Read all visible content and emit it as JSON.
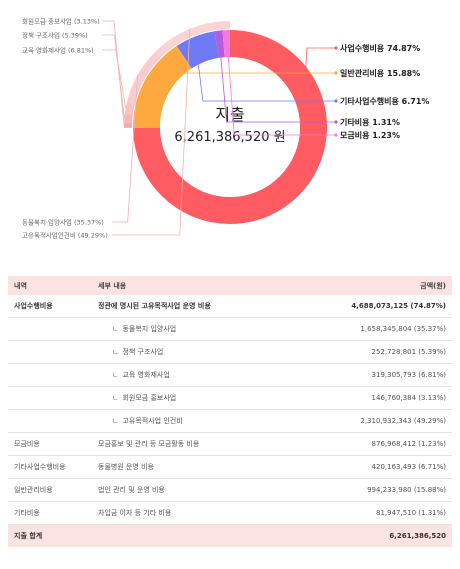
{
  "chart_data": {
    "type": "pie",
    "center_title": "지출",
    "center_value": "6,261,386,520 원",
    "slices": [
      {
        "label": "사업수행비용",
        "value": 74.87,
        "text": "사업수행비용 74.87%",
        "color": "#fe5c62"
      },
      {
        "label": "일반관리비용",
        "value": 15.88,
        "text": "일반관리비용 15.88%",
        "color": "#fea940"
      },
      {
        "label": "기타사업수행비용",
        "value": 6.71,
        "text": "기타사업수행비용 6.71%",
        "color": "#6f79f4"
      },
      {
        "label": "기타비용",
        "value": 1.31,
        "text": "기타비용 1.31%",
        "color": "#b45cdd"
      },
      {
        "label": "모금비용",
        "value": 1.23,
        "text": "모금비용 1.23%",
        "color": "#f57ae0"
      }
    ],
    "sub_slices": [
      {
        "label": "고유목적사업인건비",
        "value": 49.29,
        "text": "고유목적사업인건비 (49.29%)",
        "color": "#fbd3d3"
      },
      {
        "label": "동물복지·입양사업",
        "value": 35.37,
        "text": "동물복지·입양사업 (35.37%)",
        "color": "#fccccc"
      },
      {
        "label": "교육·영화제사업",
        "value": 6.81,
        "text": "교육·영화제사업 (6.81%)",
        "color": "#fbc2c2"
      },
      {
        "label": "정책·구조사업",
        "value": 5.39,
        "text": "정책·구조사업 (5.39%)",
        "color": "#fab6b6"
      },
      {
        "label": "회원모금·홍보사업",
        "value": 3.13,
        "text": "회원모금·홍보사업 (3.13%)",
        "color": "#f9a9a9"
      }
    ]
  },
  "table": {
    "headers": {
      "col1": "내역",
      "col2": "세부 내용",
      "col3": "금액(원)"
    },
    "rows": [
      {
        "cat": "사업수행비용",
        "detail": "정관에 명시된 고유목적사업 운영 비용",
        "amount": "4,688,073,125 (74.87%)",
        "bold": true
      },
      {
        "cat": "",
        "detail": "동물복지 입양사업",
        "amount": "1,658,345,804 (35.37%)",
        "sub": true
      },
      {
        "cat": "",
        "detail": "정책 구조사업",
        "amount": "252,728,801 (5.39%)",
        "sub": true
      },
      {
        "cat": "",
        "detail": "교육 영화제사업",
        "amount": "319,305,793 (6.81%)",
        "sub": true
      },
      {
        "cat": "",
        "detail": "회원모금 홍보사업",
        "amount": "146,760,384 (3.13%)",
        "sub": true
      },
      {
        "cat": "",
        "detail": "고유목적사업 인건비",
        "amount": "2,310,932,343 (49.29%)",
        "sub": true
      },
      {
        "cat": "모금비용",
        "detail": "모금홍보 및 관리 등 모금활동 비용",
        "amount": "876,968,412 (1.23%)"
      },
      {
        "cat": "기타사업수행비용",
        "detail": "동물병원 운영 비용",
        "amount": "420,163,493 (6.71%)"
      },
      {
        "cat": "일반관리비용",
        "detail": "법인 관리 및 운영 비용",
        "amount": "994,233,980 (15.88%)"
      },
      {
        "cat": "기타비용",
        "detail": "차입금 이자 등 기타 비용",
        "amount": "81,947,510 (1.31%)"
      }
    ],
    "total": {
      "label": "지출 합계",
      "amount": "6,261,386,520"
    }
  },
  "arrow_glyph": "ㄴ"
}
